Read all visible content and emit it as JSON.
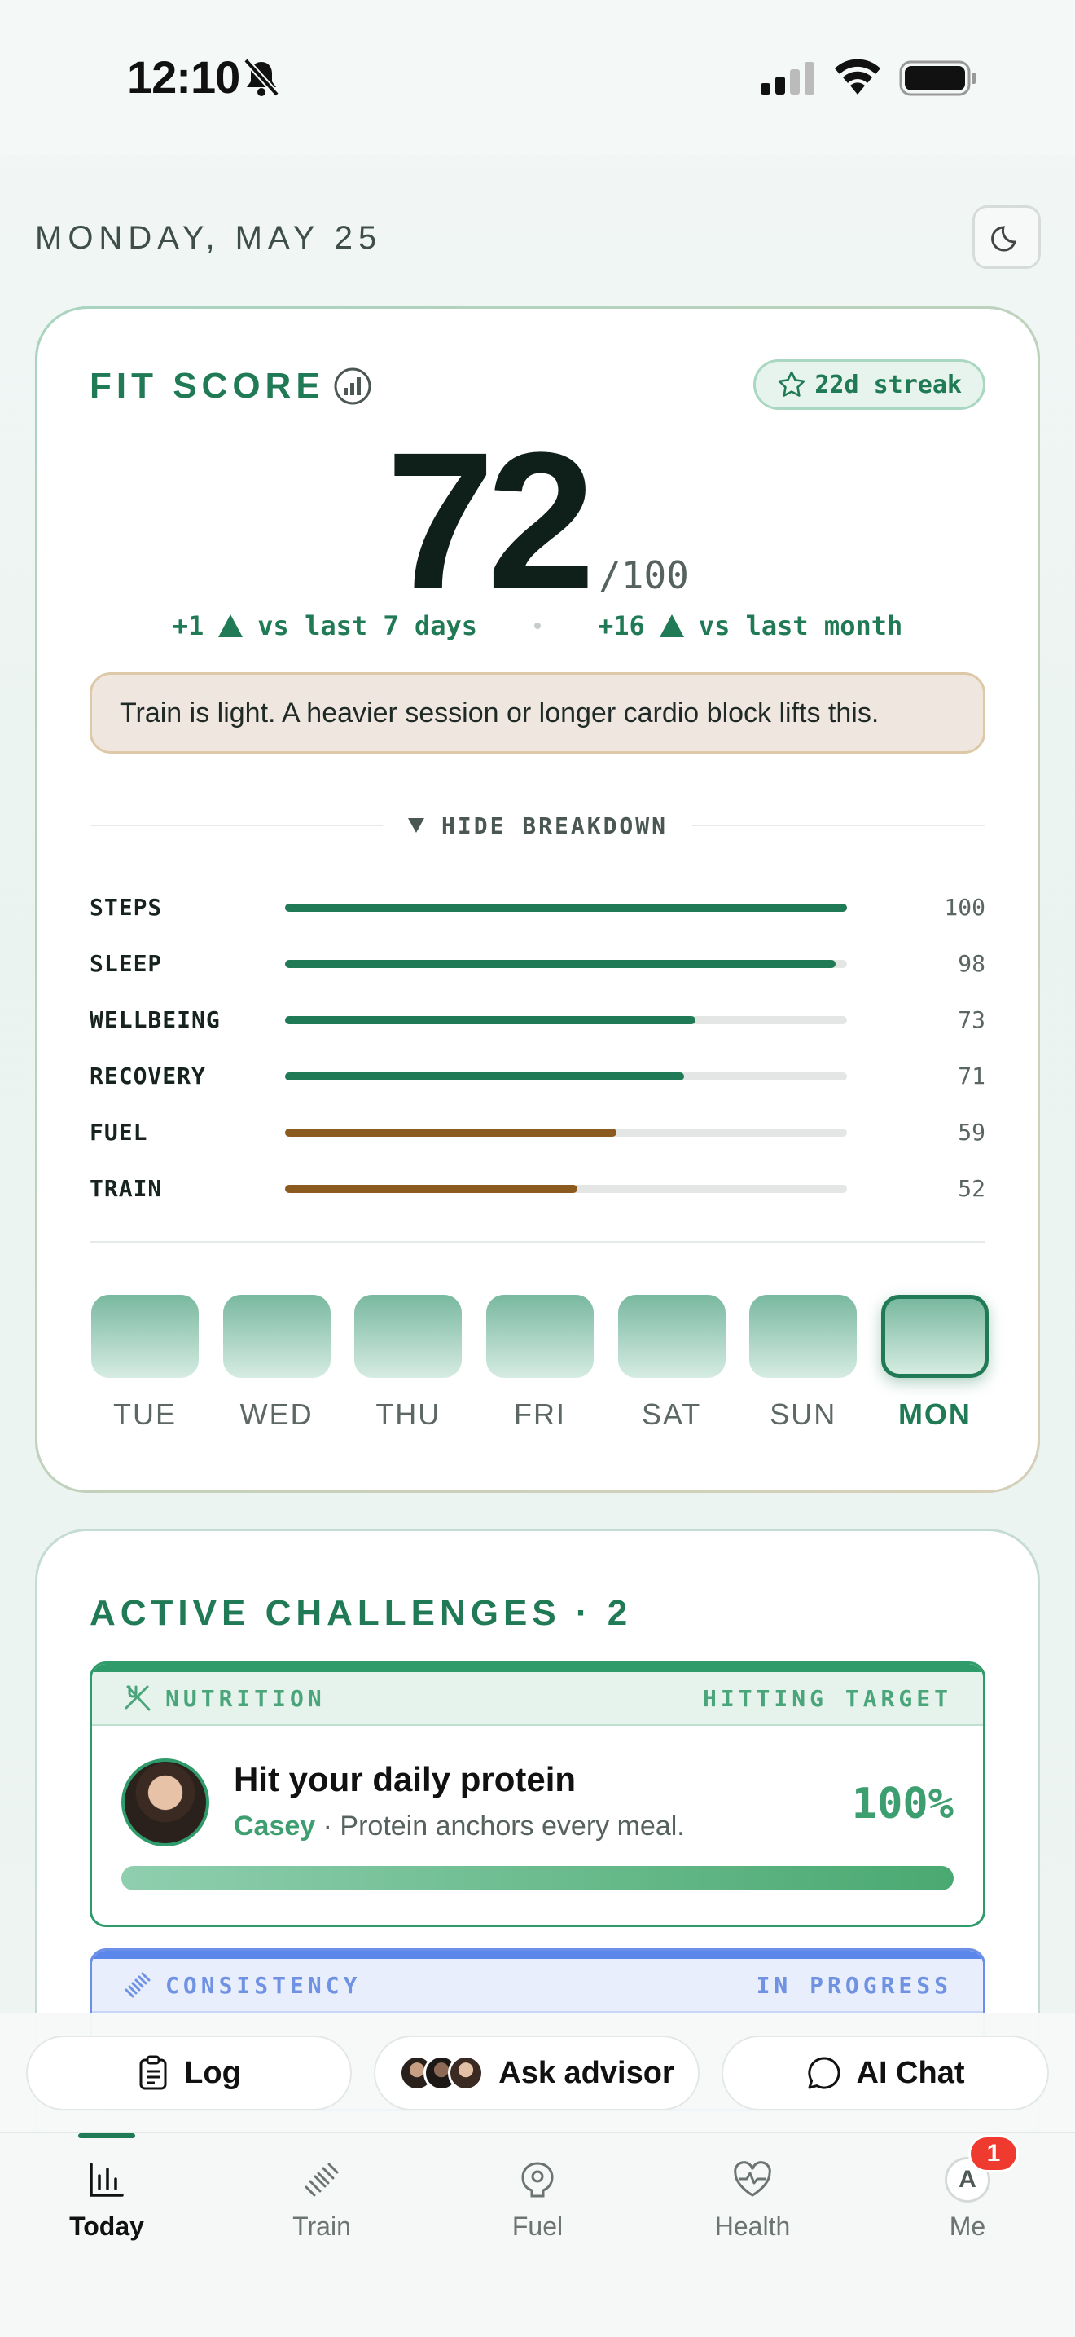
{
  "status_bar": {
    "time": "12:10"
  },
  "header": {
    "date": "MONDAY, MAY 25"
  },
  "fit_score": {
    "title": "FIT SCORE",
    "streak": "22d streak",
    "score": "72",
    "out_of": "/100",
    "delta_week_value": "+1",
    "delta_week_label": "vs last 7 days",
    "delta_month_value": "+16",
    "delta_month_label": "vs last month",
    "hint": "Train is light. A heavier session or longer cardio block lifts this.",
    "breakdown_toggle": "HIDE BREAKDOWN",
    "metrics": [
      {
        "name": "STEPS",
        "value": 100,
        "value_text": "100",
        "color": "#1f7a55"
      },
      {
        "name": "SLEEP",
        "value": 98,
        "value_text": "98",
        "color": "#1f7a55"
      },
      {
        "name": "WELLBEING",
        "value": 73,
        "value_text": "73",
        "color": "#1f7a55"
      },
      {
        "name": "RECOVERY",
        "value": 71,
        "value_text": "71",
        "color": "#1f7a55"
      },
      {
        "name": "FUEL",
        "value": 59,
        "value_text": "59",
        "color": "#8a5a1e"
      },
      {
        "name": "TRAIN",
        "value": 52,
        "value_text": "52",
        "color": "#8a5a1e"
      }
    ],
    "days": [
      {
        "label": "TUE"
      },
      {
        "label": "WED"
      },
      {
        "label": "THU"
      },
      {
        "label": "FRI"
      },
      {
        "label": "SAT"
      },
      {
        "label": "SUN"
      },
      {
        "label": "MON",
        "today": true
      }
    ]
  },
  "challenges": {
    "title": "ACTIVE CHALLENGES · 2",
    "items": [
      {
        "category": "NUTRITION",
        "status": "HITTING TARGET",
        "name": "Hit your daily protein",
        "coach": "Casey",
        "subtitle": " · Protein anchors every meal.",
        "percent": "100%",
        "progress": 1.0
      },
      {
        "category": "CONSISTENCY",
        "status": "IN PROGRESS"
      }
    ]
  },
  "actions": {
    "log": "Log",
    "advisor": "Ask advisor",
    "chat": "AI Chat"
  },
  "tabs": [
    {
      "label": "Today",
      "icon": "chart-icon",
      "active": true
    },
    {
      "label": "Train",
      "icon": "dumbbell-icon"
    },
    {
      "label": "Fuel",
      "icon": "plate-icon"
    },
    {
      "label": "Health",
      "icon": "heart-pulse-icon"
    },
    {
      "label": "Me",
      "icon": "avatar-icon",
      "avatar_letter": "A",
      "badge": "1"
    }
  ],
  "colors": {
    "accent": "#1f7a55",
    "warn": "#8a5a1e",
    "info": "#5b86ea",
    "badge": "#ef3b2f"
  }
}
